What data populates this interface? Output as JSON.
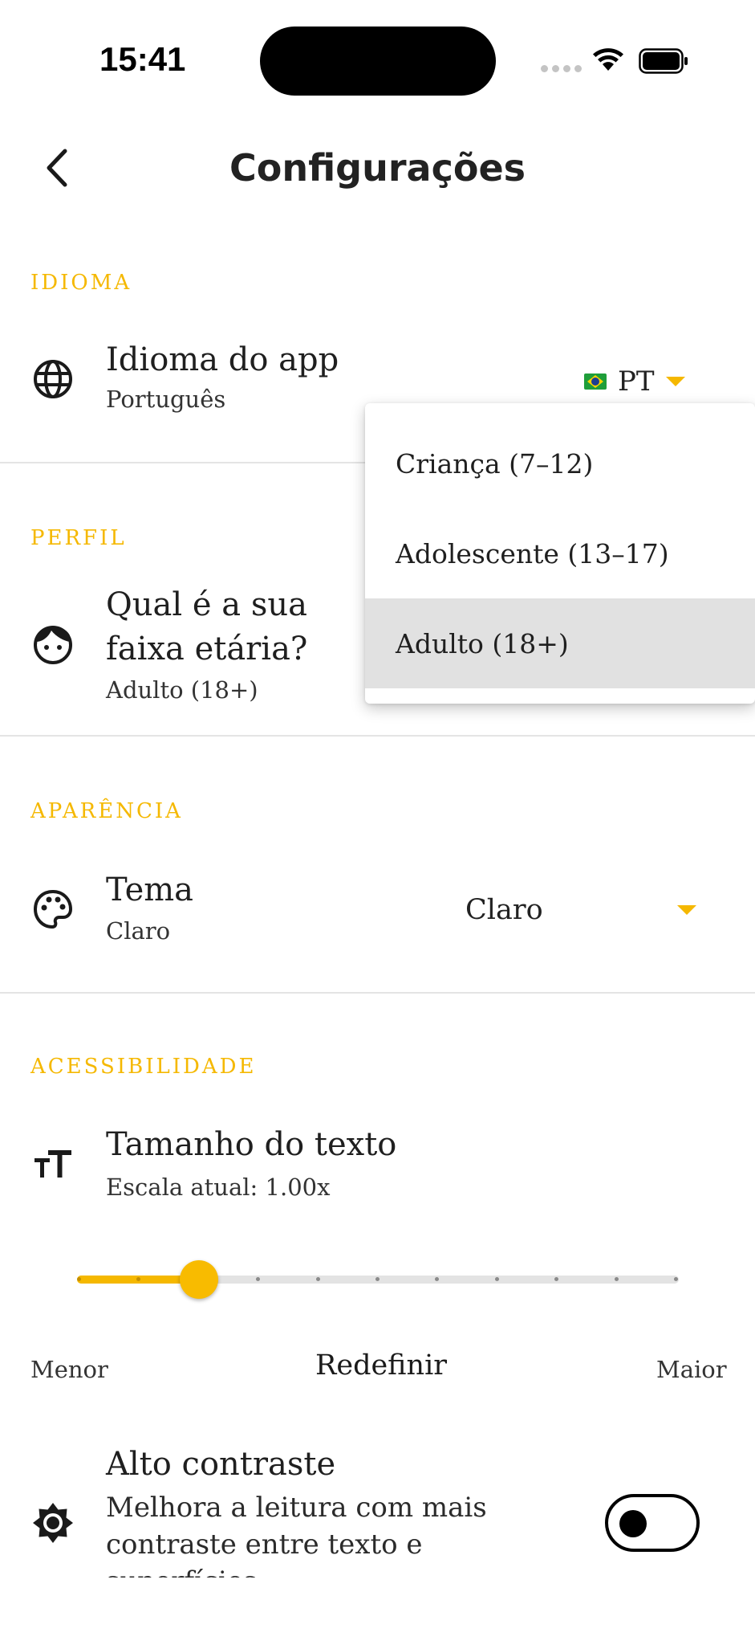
{
  "status_bar": {
    "time": "15:41"
  },
  "header": {
    "title": "Configurações"
  },
  "sections": {
    "language": {
      "label": "IDIOMA",
      "title": "Idioma do app",
      "value": "Português",
      "code": "PT"
    },
    "profile": {
      "label": "PERFIL",
      "title_line1": "Qual é a sua",
      "title_line2": "faixa etária?",
      "value": "Adulto (18+)"
    },
    "appearance": {
      "label": "APARÊNCIA",
      "title": "Tema",
      "value": "Claro",
      "select_value": "Claro"
    },
    "accessibility": {
      "label": "ACESSIBILIDADE",
      "text_size_title": "Tamanho do texto",
      "text_size_sub": "Escala atual: 1.00x",
      "slider_steps": 11,
      "slider_selected_step": 2,
      "smaller_label": "Menor",
      "reset_label": "Redefinir",
      "larger_label": "Maior",
      "high_contrast_title": "Alto contraste",
      "high_contrast_desc": "Melhora a leitura com mais contraste entre texto e superfícies",
      "high_contrast_enabled": false
    }
  },
  "age_dropdown": {
    "options": [
      "Criança (7–12)",
      "Adolescente (13–17)",
      "Adulto (18+)"
    ],
    "selected_index": 2
  },
  "colors": {
    "accent": "#f5b800",
    "selected_bg": "#e1e1e1",
    "divider": "#e4e4e4"
  },
  "icons": [
    "chevron-left-icon",
    "globe-icon",
    "face-icon",
    "palette-icon",
    "text-size-icon",
    "brightness-icon"
  ]
}
